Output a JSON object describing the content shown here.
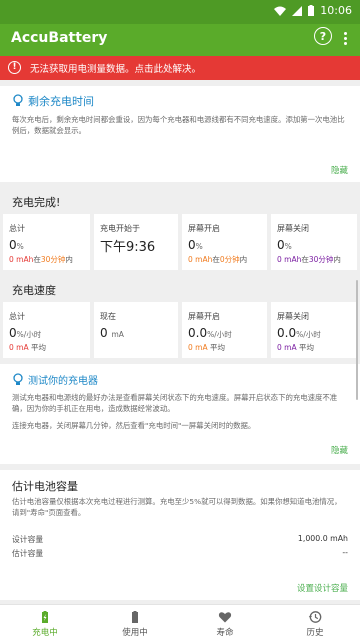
{
  "status": {
    "time": "10:06"
  },
  "app": {
    "title": "AccuBattery"
  },
  "error": {
    "text": "无法获取用电测量数据。点击此处解决。"
  },
  "remaining": {
    "title": "剩余充电时间",
    "text": "每次充电后，剩余充电时间都会重设，因为每个充电器和电源线都有不同充电速度。添加第一次电池比例后，数据就会显示。",
    "hide": "隐藏"
  },
  "charge_done": {
    "title": "充电完成!",
    "cards": [
      {
        "label": "总计",
        "value": "0",
        "unit": "%",
        "sub_value": "0 mAh",
        "sub_mid": "在",
        "sub_time": "30分钟",
        "sub_suffix": "内"
      },
      {
        "label": "充电开始于",
        "value": "下午9:36"
      },
      {
        "label": "屏幕开启",
        "value": "0",
        "unit": "%",
        "sub_value": "0 mAh",
        "sub_mid": "在",
        "sub_time": "0分钟",
        "sub_suffix": "内"
      },
      {
        "label": "屏幕关闭",
        "value": "0",
        "unit": "%",
        "sub_value": "0 mAh",
        "sub_mid": "在",
        "sub_time": "30分钟",
        "sub_suffix": "内"
      }
    ]
  },
  "charge_speed": {
    "title": "充电速度",
    "cards": [
      {
        "label": "总计",
        "value": "0",
        "unit": "%/小时",
        "sub_value": "0 mA",
        "sub_suffix": "平均"
      },
      {
        "label": "现在",
        "value": "0",
        "unit": "mA"
      },
      {
        "label": "屏幕开启",
        "value": "0.0",
        "unit": "%/小时",
        "sub_value": "0 mA",
        "sub_suffix": "平均"
      },
      {
        "label": "屏幕关闭",
        "value": "0.0",
        "unit": "%/小时",
        "sub_value": "0 mA",
        "sub_suffix": "平均"
      }
    ]
  },
  "test_charger": {
    "title": "测试你的充电器",
    "text1": "测试充电器和电源线的最好办法是查看屏幕关闭状态下的充电速度。屏幕开启状态下的充电速度不准确，因为你的手机正在用电，造成数据经常波动。",
    "text2": "连接充电器，关闭屏幕几分钟，然后查看\"充电时间\"一屏幕关闭时的数据。",
    "hide": "隐藏"
  },
  "capacity": {
    "title": "估计电池容量",
    "text": "估计电池容量仅根据本次充电过程进行测算。充电至少5%就可以得到数据。如果你想知道电池情况，请到\"寿命\"页面查看。",
    "rows": [
      {
        "label": "设计容量",
        "value": "1,000.0 mAh"
      },
      {
        "label": "估计容量",
        "value": "--"
      }
    ],
    "link": "设置设计容量"
  },
  "nav": {
    "items": [
      {
        "label": "充电中",
        "icon": "battery-charging-icon"
      },
      {
        "label": "使用中",
        "icon": "battery-icon"
      },
      {
        "label": "寿命",
        "icon": "heart-icon"
      },
      {
        "label": "历史",
        "icon": "history-icon"
      }
    ]
  },
  "colors": {
    "green": "#5aab2a",
    "red": "#e53935",
    "orange": "#f07b1f",
    "blue": "#1e88c7",
    "purple": "#7b1fa2"
  }
}
